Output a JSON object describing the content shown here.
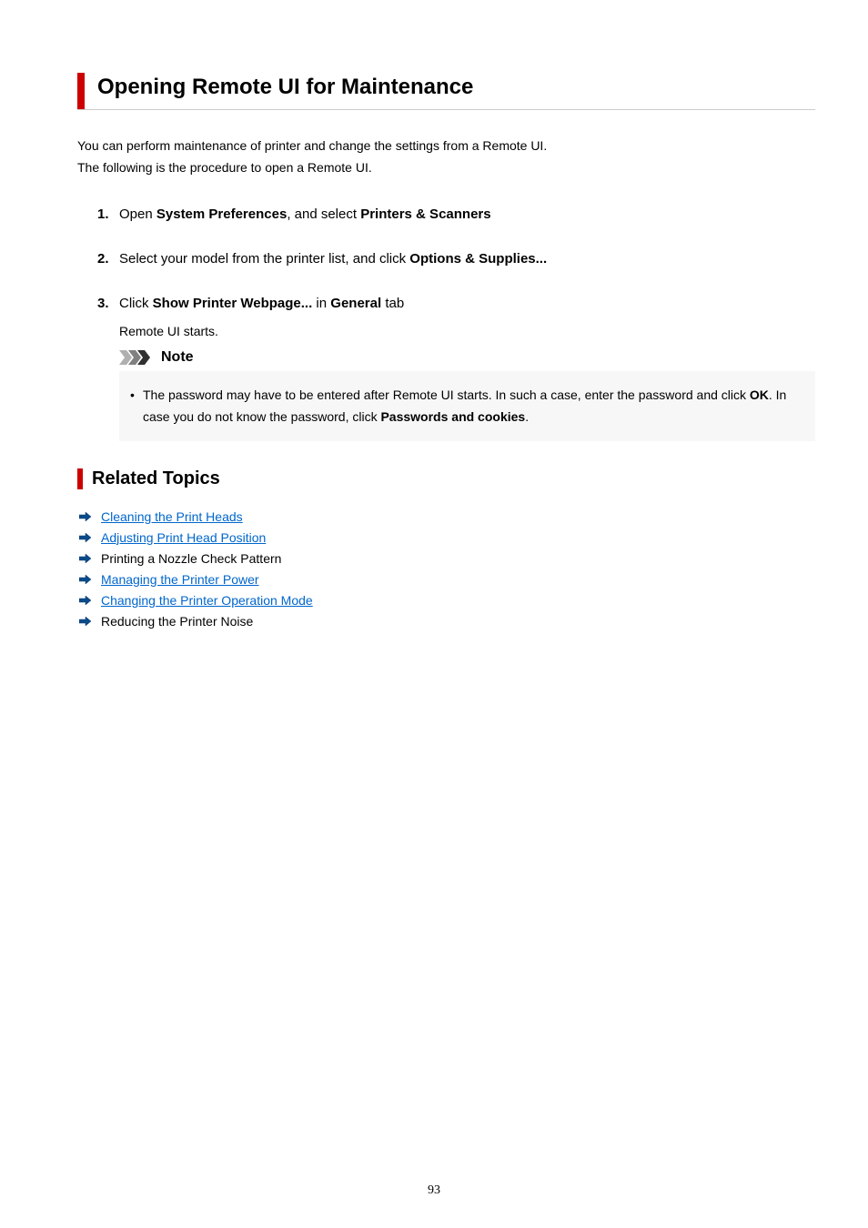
{
  "title": "Opening Remote UI for Maintenance",
  "intro_line1": "You can perform maintenance of printer and change the settings from a Remote UI.",
  "intro_line2": "The following is the procedure to open a Remote UI.",
  "steps": [
    {
      "num": "1.",
      "prefix": "Open ",
      "b1": "System Preferences",
      "mid": ", and select ",
      "b2": "Printers & Scanners",
      "suffix": ""
    },
    {
      "num": "2.",
      "prefix": "Select your model from the printer list, and click ",
      "b1": "Options & Supplies...",
      "mid": "",
      "b2": "",
      "suffix": ""
    },
    {
      "num": "3.",
      "prefix": "Click ",
      "b1": "Show Printer Webpage...",
      "mid": " in ",
      "b2": "General",
      "suffix": " tab"
    }
  ],
  "step3_sub": "Remote UI starts.",
  "note_label": "Note",
  "note_text_p1": "The password may have to be entered after Remote UI starts. In such a case, enter the password and click ",
  "note_text_b1": "OK",
  "note_text_p2": ". In case you do not know the password, click ",
  "note_text_b2": "Passwords and cookies",
  "note_text_p3": ".",
  "related_heading": "Related Topics",
  "related_items": [
    {
      "label": "Cleaning the Print Heads",
      "link": true
    },
    {
      "label": "Adjusting Print Head Position",
      "link": true
    },
    {
      "label": "Printing a Nozzle Check Pattern",
      "link": false
    },
    {
      "label": "Managing the Printer Power",
      "link": true
    },
    {
      "label": "Changing the Printer Operation Mode",
      "link": true
    },
    {
      "label": "Reducing the Printer Noise",
      "link": false
    }
  ],
  "page_number": "93"
}
